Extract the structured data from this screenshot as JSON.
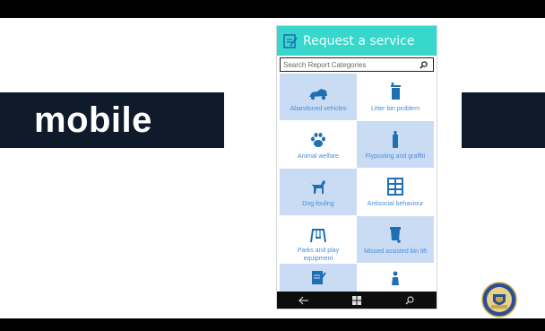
{
  "slide": {
    "brand_text": "mobile"
  },
  "app": {
    "header_title": "Request a service",
    "search_placeholder": "Search Report Categories",
    "accent_color": "#38d7cc",
    "tile_color": "#c9dcf3",
    "label_color": "#4a8fd8",
    "tiles": [
      {
        "label": "Abandoned vehicles",
        "icon": "car-icon",
        "shade": "dark"
      },
      {
        "label": "Litter bin problem",
        "icon": "litter-bin-icon",
        "shade": "light"
      },
      {
        "label": "Animal welfare",
        "icon": "paw-icon",
        "shade": "light"
      },
      {
        "label": "Flyposting and graffiti",
        "icon": "spray-can-icon",
        "shade": "dark"
      },
      {
        "label": "Dog fouling",
        "icon": "dog-icon",
        "shade": "dark"
      },
      {
        "label": "Antisocial behaviour",
        "icon": "building-icon",
        "shade": "light"
      },
      {
        "label": "Parks and play equipment",
        "icon": "swing-icon",
        "shade": "light"
      },
      {
        "label": "Missed assisted bin lift",
        "icon": "wheelie-bin-icon",
        "shade": "dark"
      },
      {
        "label": "",
        "icon": "notepad-icon",
        "shade": "dark"
      },
      {
        "label": "",
        "icon": "person-icon",
        "shade": "light"
      }
    ],
    "nav": {
      "back_icon": "back-arrow-icon",
      "home_icon": "windows-icon",
      "search_icon": "search-icon"
    }
  }
}
